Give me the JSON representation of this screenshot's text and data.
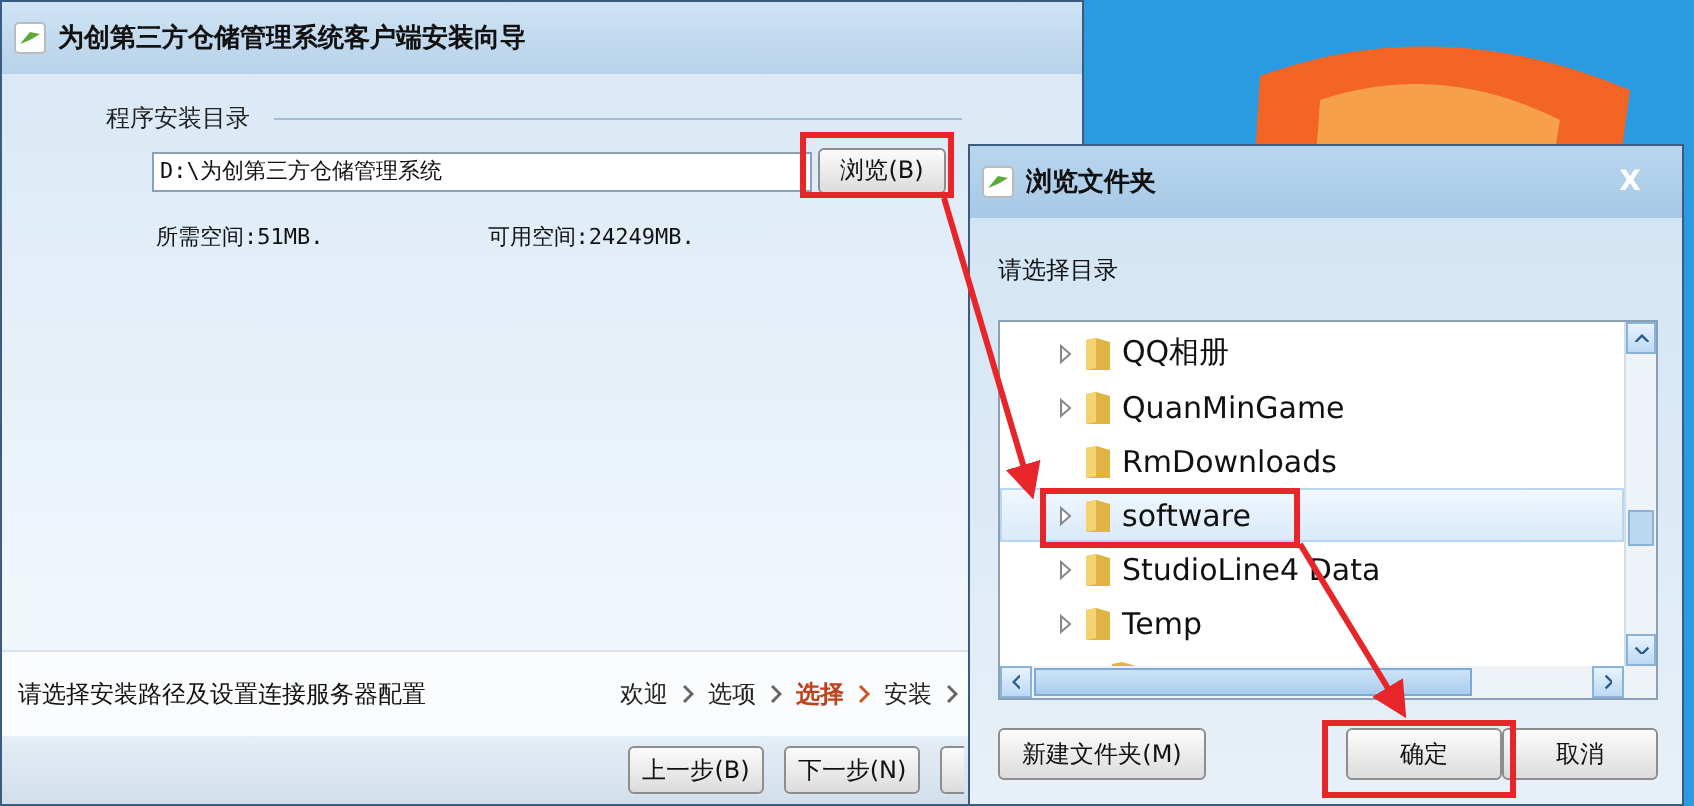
{
  "main_window": {
    "title": "为创第三方仓储管理系统客户端安装向导",
    "group_label": "程序安装目录",
    "path": {
      "value": "D:\\为创第三方仓储管理系统"
    },
    "browse_button": "浏览(B)",
    "required_space": "所需空间:51MB.",
    "free_space": "可用空间:24249MB.",
    "status_text": "请选择安装路径及设置连接服务器配置",
    "steps": [
      {
        "label": "欢迎",
        "selected": false
      },
      {
        "label": "选项",
        "selected": false
      },
      {
        "label": "选择",
        "selected": true
      },
      {
        "label": "安装",
        "selected": false
      }
    ],
    "buttons": [
      "上一步(B)",
      "下一步(N)"
    ]
  },
  "dialog": {
    "title": "浏览文件夹",
    "close": "X",
    "prompt": "请选择目录",
    "folders": [
      {
        "name": "QQ相册",
        "expandable": true,
        "selected": false
      },
      {
        "name": "QuanMinGame",
        "expandable": true,
        "selected": false
      },
      {
        "name": "RmDownloads",
        "expandable": false,
        "selected": false
      },
      {
        "name": "software",
        "expandable": true,
        "selected": true
      },
      {
        "name": "StudioLine4 Data",
        "expandable": true,
        "selected": false
      },
      {
        "name": "Temp",
        "expandable": true,
        "selected": false
      }
    ],
    "new_folder_button": "新建文件夹(M)",
    "ok_button": "确定",
    "cancel_button": "取消"
  }
}
